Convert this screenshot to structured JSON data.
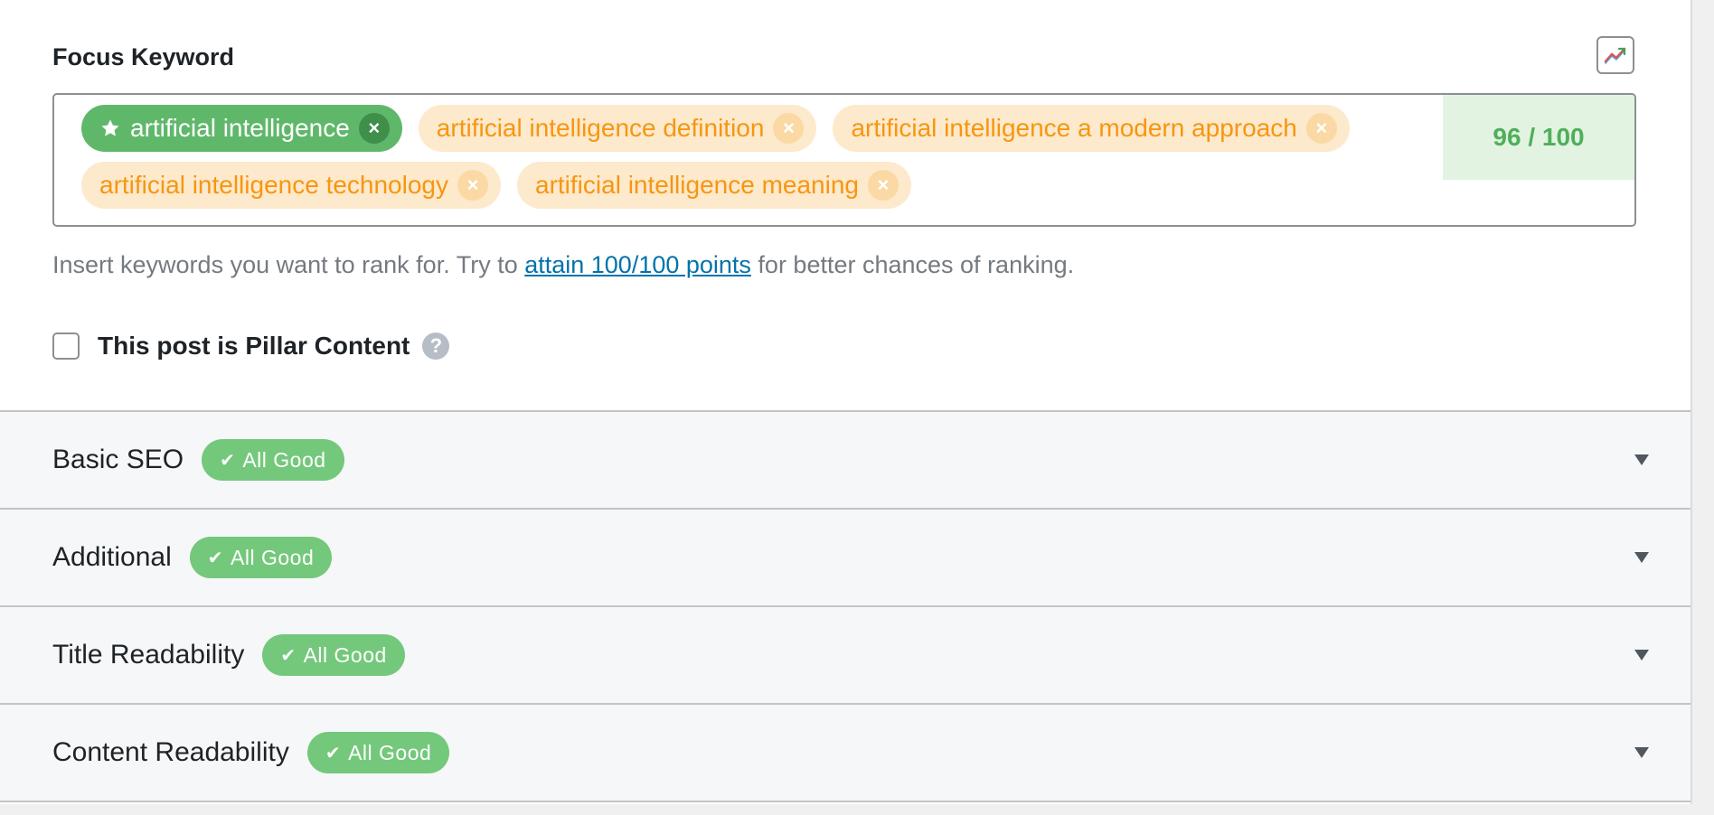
{
  "focus_keyword": {
    "label": "Focus Keyword",
    "trend_button_icon": "trend-chart-icon",
    "keywords": [
      {
        "text": "artificial intelligence",
        "primary": true
      },
      {
        "text": "artificial intelligence definition",
        "primary": false
      },
      {
        "text": "artificial intelligence a modern approach",
        "primary": false
      },
      {
        "text": "artificial intelligence technology",
        "primary": false
      },
      {
        "text": "artificial intelligence meaning",
        "primary": false
      }
    ],
    "score": "96 / 100",
    "help_prefix": "Insert keywords you want to rank for. Try to ",
    "help_link": "attain 100/100 points",
    "help_suffix": " for better chances of ranking.",
    "remove_glyph": "×",
    "star_icon": "star-icon"
  },
  "pillar": {
    "label": "This post is Pillar Content",
    "checked": false,
    "help_glyph": "?"
  },
  "sections": [
    {
      "title": "Basic SEO",
      "badge": "All Good"
    },
    {
      "title": "Additional",
      "badge": "All Good"
    },
    {
      "title": "Title Readability",
      "badge": "All Good"
    },
    {
      "title": "Content Readability",
      "badge": "All Good"
    }
  ],
  "colors": {
    "primary_tag": "#5fb86a",
    "secondary_tag_bg": "#fde9cc",
    "secondary_tag_text": "#f7960f",
    "score_bg": "#e3f3e1",
    "score_text": "#4eaf5b",
    "badge_bg": "#74c87b",
    "link": "#0073aa"
  }
}
